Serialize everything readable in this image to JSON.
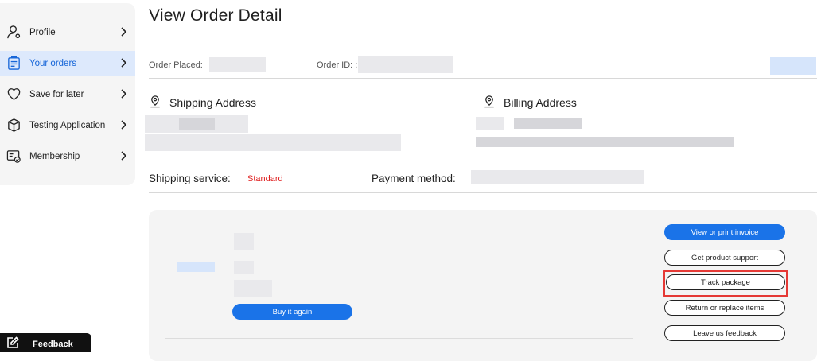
{
  "sidebar": {
    "items": [
      {
        "label": "Profile",
        "icon": "user-icon"
      },
      {
        "label": "Your orders",
        "icon": "clipboard-icon"
      },
      {
        "label": "Save for later",
        "icon": "heart-icon"
      },
      {
        "label": "Testing Application",
        "icon": "box-icon"
      },
      {
        "label": "Membership",
        "icon": "membership-card-icon"
      }
    ]
  },
  "header": {
    "title": "View Order Detail",
    "order_placed_label": "Order Placed:",
    "order_id_label": "Order ID: :"
  },
  "shipping": {
    "title": "Shipping Address",
    "service_label": "Shipping service:",
    "service_value": "Standard"
  },
  "billing": {
    "title": "Billing Address",
    "payment_label": "Payment method:"
  },
  "order_item": {
    "buy_again_label": "Buy it again"
  },
  "actions": {
    "view_invoice": "View or print invoice",
    "product_support": "Get product support",
    "track_package": "Track package",
    "return_replace": "Return or replace items",
    "leave_feedback": "Leave us feedback"
  },
  "feedback_tab": {
    "label": "Feedback"
  },
  "colors": {
    "accent": "#1a73e8",
    "active_bg": "#dde9fc",
    "highlight": "#e53935",
    "service_text": "#e02020"
  }
}
